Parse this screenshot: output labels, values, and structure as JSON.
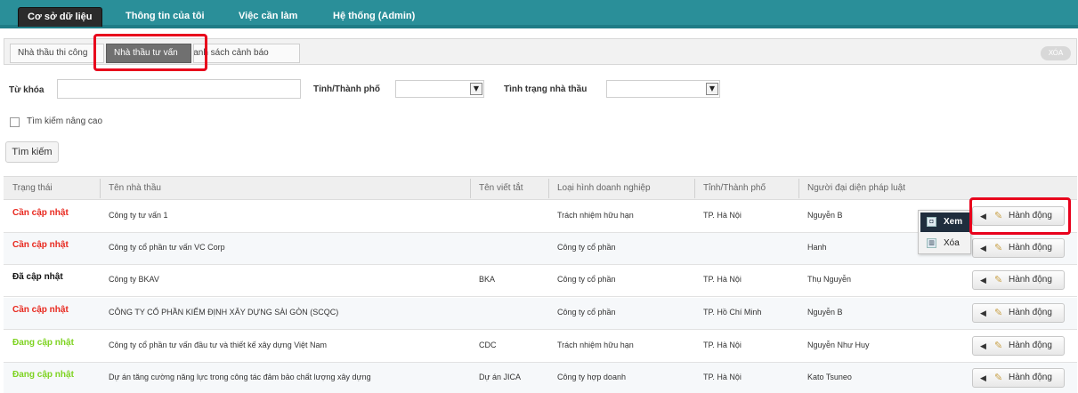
{
  "nav": {
    "items": [
      "Cơ sở dữ liệu",
      "Thông tin của tôi",
      "Việc cần làm",
      "Hệ thống (Admin)"
    ]
  },
  "subtabs": {
    "items": [
      "Nhà thầu thi công",
      "Nhà thầu tư vấn",
      "Danh sách cảnh báo"
    ],
    "corner_label": "XÓA"
  },
  "filters": {
    "keyword_label": "Từ khóa",
    "province_label": "Tỉnh/Thành phố",
    "status_label": "Tình trạng nhà thầu",
    "advanced_label": "Tìm kiếm nâng cao",
    "search_button": "Tìm kiếm"
  },
  "table": {
    "headers": [
      "Trạng thái",
      "Tên nhà thầu",
      "Tên viết tắt",
      "Loại hình doanh nghiệp",
      "Tỉnh/Thành phố",
      "Người đại diện pháp luật"
    ],
    "action_label": "Hành động",
    "rows": [
      {
        "status": "Cần cập nhật",
        "status_color": "#e8281e",
        "name": "Công ty tư vấn 1",
        "abbr": "",
        "type": "Trách nhiệm hữu hạn",
        "province": "TP. Hà Nội",
        "rep": "Nguyễn B"
      },
      {
        "status": "Cần cập nhật",
        "status_color": "#e8281e",
        "name": "Công ty cổ phần tư vấn VC Corp",
        "abbr": "",
        "type": "Công ty cổ phần",
        "province": "",
        "rep": "Hanh"
      },
      {
        "status": "Đã cập nhật",
        "status_color": "#111111",
        "name": "Công ty BKAV",
        "abbr": "BKA",
        "type": "Công ty cổ phần",
        "province": "TP. Hà Nội",
        "rep": "Thụ Nguyễn"
      },
      {
        "status": "Cần cập nhật",
        "status_color": "#e8281e",
        "name": "CÔNG TY CỔ PHẦN KIỂM ĐỊNH XÂY DỰNG SÀI GÒN (SCQC)",
        "abbr": "",
        "type": "Công ty cổ phần",
        "province": "TP. Hồ Chí Minh",
        "rep": "Nguyễn B"
      },
      {
        "status": "Đang cập nhật",
        "status_color": "#7ed321",
        "name": "Công ty cổ phần tư vấn đầu tư và thiết kế xây dựng Việt Nam",
        "abbr": "CDC",
        "type": "Trách nhiệm hữu hạn",
        "province": "TP. Hà Nội",
        "rep": "Nguyễn Như Huy"
      },
      {
        "status": "Đang cập nhật",
        "status_color": "#7ed321",
        "name": "Dự án tăng cường năng lực trong công tác đảm bảo chất lượng xây dựng",
        "abbr": "Dự án JICA",
        "type": "Công ty hợp doanh",
        "province": "TP. Hà Nội",
        "rep": "Kato Tsuneo"
      }
    ]
  },
  "popup": {
    "view": "Xem",
    "delete": "Xóa"
  },
  "colors": {
    "nav_bg": "#2a8f99",
    "highlight": "#e8001c"
  }
}
